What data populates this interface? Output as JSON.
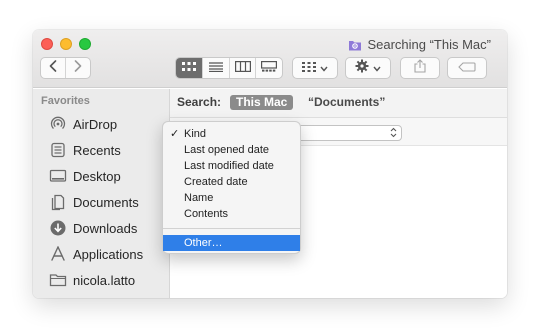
{
  "window": {
    "title": "Searching “This Mac”",
    "title_icon": "smart-folder-icon"
  },
  "toolbar": {
    "back_icon": "chevron-left-icon",
    "forward_icon": "chevron-right-icon",
    "views": [
      "icon-view-icon",
      "list-view-icon",
      "column-view-icon",
      "gallery-view-icon"
    ],
    "active_view": "icon-view-icon",
    "group_icon": "group-icon",
    "action_icon": "gear-icon",
    "share_icon": "share-icon",
    "tag_icon": "tag-icon"
  },
  "sidebar": {
    "section_title": "Favorites",
    "items": [
      {
        "label": "AirDrop",
        "icon": "airdrop-icon"
      },
      {
        "label": "Recents",
        "icon": "recents-icon"
      },
      {
        "label": "Desktop",
        "icon": "desktop-icon"
      },
      {
        "label": "Documents",
        "icon": "documents-icon"
      },
      {
        "label": "Downloads",
        "icon": "downloads-icon"
      },
      {
        "label": "Applications",
        "icon": "applications-icon"
      },
      {
        "label": "nicola.latto",
        "icon": "home-folder-icon"
      }
    ]
  },
  "search": {
    "label": "Search:",
    "scope_active": "This Mac",
    "scope_other": "“Documents”"
  },
  "menu": {
    "items": [
      {
        "label": "Kind",
        "checked": true
      },
      {
        "label": "Last opened date",
        "checked": false
      },
      {
        "label": "Last modified date",
        "checked": false
      },
      {
        "label": "Created date",
        "checked": false
      },
      {
        "label": "Name",
        "checked": false
      },
      {
        "label": "Contents",
        "checked": false
      }
    ],
    "other_label": "Other…",
    "check_mark": "✓"
  },
  "colors": {
    "close": "#fc5f57",
    "minimize": "#fdbc2e",
    "maximize": "#28c840",
    "highlight": "#2f7fe8",
    "smart_folder": "#8e7ad8"
  }
}
